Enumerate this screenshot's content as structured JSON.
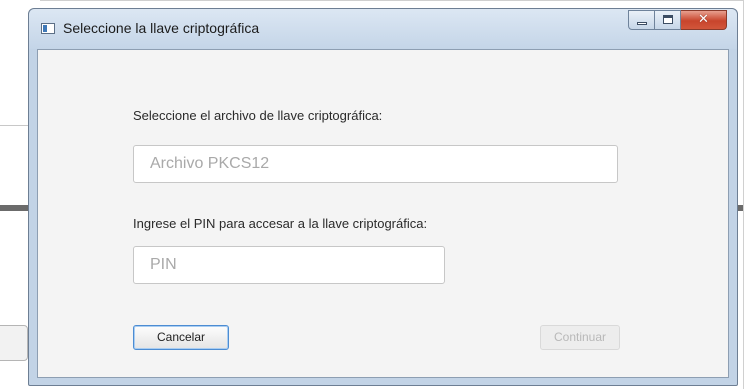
{
  "window": {
    "title": "Seleccione la llave criptográfica",
    "icon": "app-window-icon",
    "controls": {
      "minimize_icon": "minimize-icon",
      "maximize_icon": "maximize-icon",
      "close_glyph": "✕"
    }
  },
  "form": {
    "file_label": "Seleccione el archivo de llave criptográfica:",
    "file_placeholder": "Archivo PKCS12",
    "file_value": "",
    "pin_label": "Ingrese el PIN para accesar a la llave criptográfica:",
    "pin_placeholder": "PIN",
    "pin_value": ""
  },
  "buttons": {
    "cancel_label": "Cancelar",
    "continue_label": "Continuar",
    "continue_enabled": false
  },
  "colors": {
    "accent": "#4c8cd2",
    "close_button": "#c8452c",
    "titlebar": "#c4d5e8",
    "client_background": "#f4f4f4",
    "disabled_text": "#b8b8b8"
  }
}
